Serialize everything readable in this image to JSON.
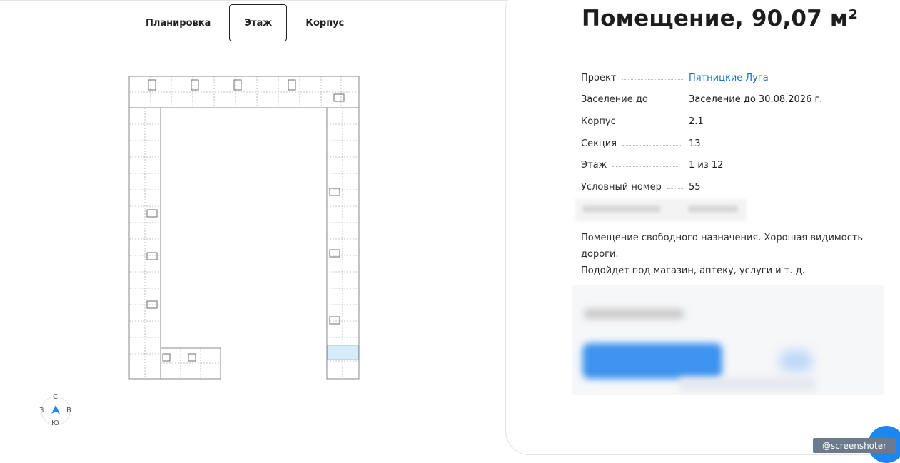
{
  "tabs": [
    "Планировка",
    "Этаж",
    "Корпус"
  ],
  "active_tab": "Этаж",
  "compass": {
    "n": "С",
    "s": "Ю",
    "w": "З",
    "e": "В"
  },
  "title": "Помещение, 90,07 м²",
  "params": [
    {
      "label": "Проект",
      "value": "Пятницкие Луга"
    },
    {
      "label": "Заселение до",
      "value": "Заселение до 30.08.2026 г."
    },
    {
      "label": "Корпус",
      "value": "2.1"
    },
    {
      "label": "Секция",
      "value": "13"
    },
    {
      "label": "Этаж",
      "value": "1 из 12"
    },
    {
      "label": "Условный номер",
      "value": "55"
    }
  ],
  "description": [
    "Помещение свободного назначения. Хорошая видимость дороги.",
    "Подойдет под магазин, аптеку, услуги и т. д."
  ],
  "badge": "@screenshoter",
  "colors": {
    "link": "#1a73c8",
    "highlight": "#d6ecf8",
    "compass_arrow": "#1f86f0"
  }
}
